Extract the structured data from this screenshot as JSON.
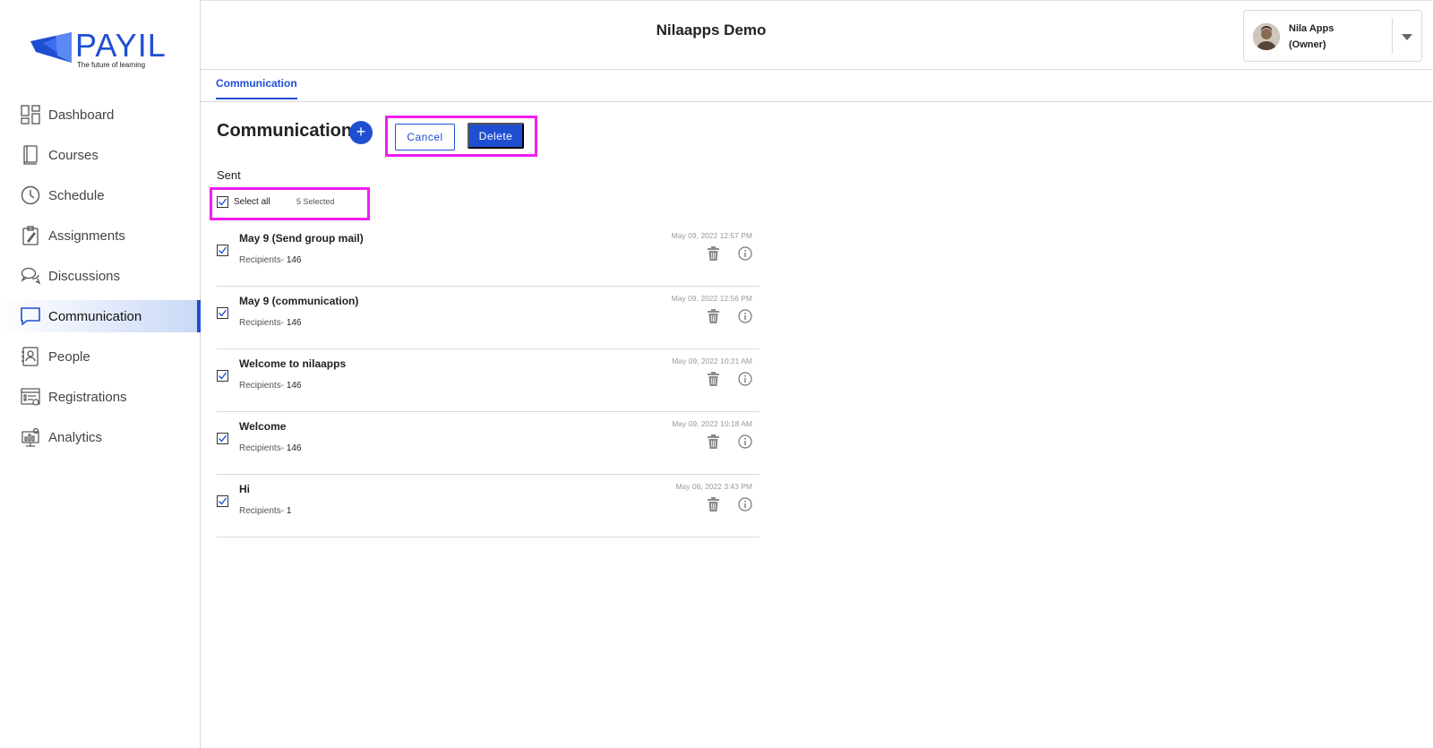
{
  "brand": {
    "name": "PAYIL",
    "tagline": "The future of learning",
    "color": "#1f4fd1"
  },
  "sidebar": {
    "items": [
      {
        "label": "Dashboard",
        "icon": "dashboard-icon"
      },
      {
        "label": "Courses",
        "icon": "book-icon"
      },
      {
        "label": "Schedule",
        "icon": "clock-icon"
      },
      {
        "label": "Assignments",
        "icon": "clipboard-icon"
      },
      {
        "label": "Discussions",
        "icon": "chat-bubbles-icon"
      },
      {
        "label": "Communication",
        "icon": "message-icon",
        "active": true
      },
      {
        "label": "People",
        "icon": "contact-book-icon"
      },
      {
        "label": "Registrations",
        "icon": "form-icon"
      },
      {
        "label": "Analytics",
        "icon": "analytics-icon"
      }
    ]
  },
  "header": {
    "title": "Nilaapps Demo",
    "user": {
      "name": "Nila Apps",
      "role": "(Owner)"
    }
  },
  "tabs": [
    {
      "label": "Communication"
    }
  ],
  "main": {
    "title": "Communication",
    "add_label": "+",
    "cancel_label": "Cancel",
    "delete_label": "Delete",
    "section_label": "Sent",
    "select_all_label": "Select all",
    "selected_count": "5 Selected",
    "highlight_color": "#f21ef2",
    "messages": [
      {
        "subject": "May 9 (Send group mail)",
        "recipients_label": "Recipients-",
        "recipients": "146",
        "date": "May 09, 2022 12:57 PM"
      },
      {
        "subject": "May 9 (communication)",
        "recipients_label": "Recipients-",
        "recipients": "146",
        "date": "May 09, 2022 12:56 PM"
      },
      {
        "subject": "Welcome to nilaapps",
        "recipients_label": "Recipients-",
        "recipients": "146",
        "date": "May 09, 2022 10:21 AM"
      },
      {
        "subject": "Welcome",
        "recipients_label": "Recipients-",
        "recipients": "146",
        "date": "May 09, 2022 10:18 AM"
      },
      {
        "subject": "Hi",
        "recipients_label": "Recipients-",
        "recipients": "1",
        "date": "May 06, 2022 3:43 PM"
      }
    ]
  }
}
